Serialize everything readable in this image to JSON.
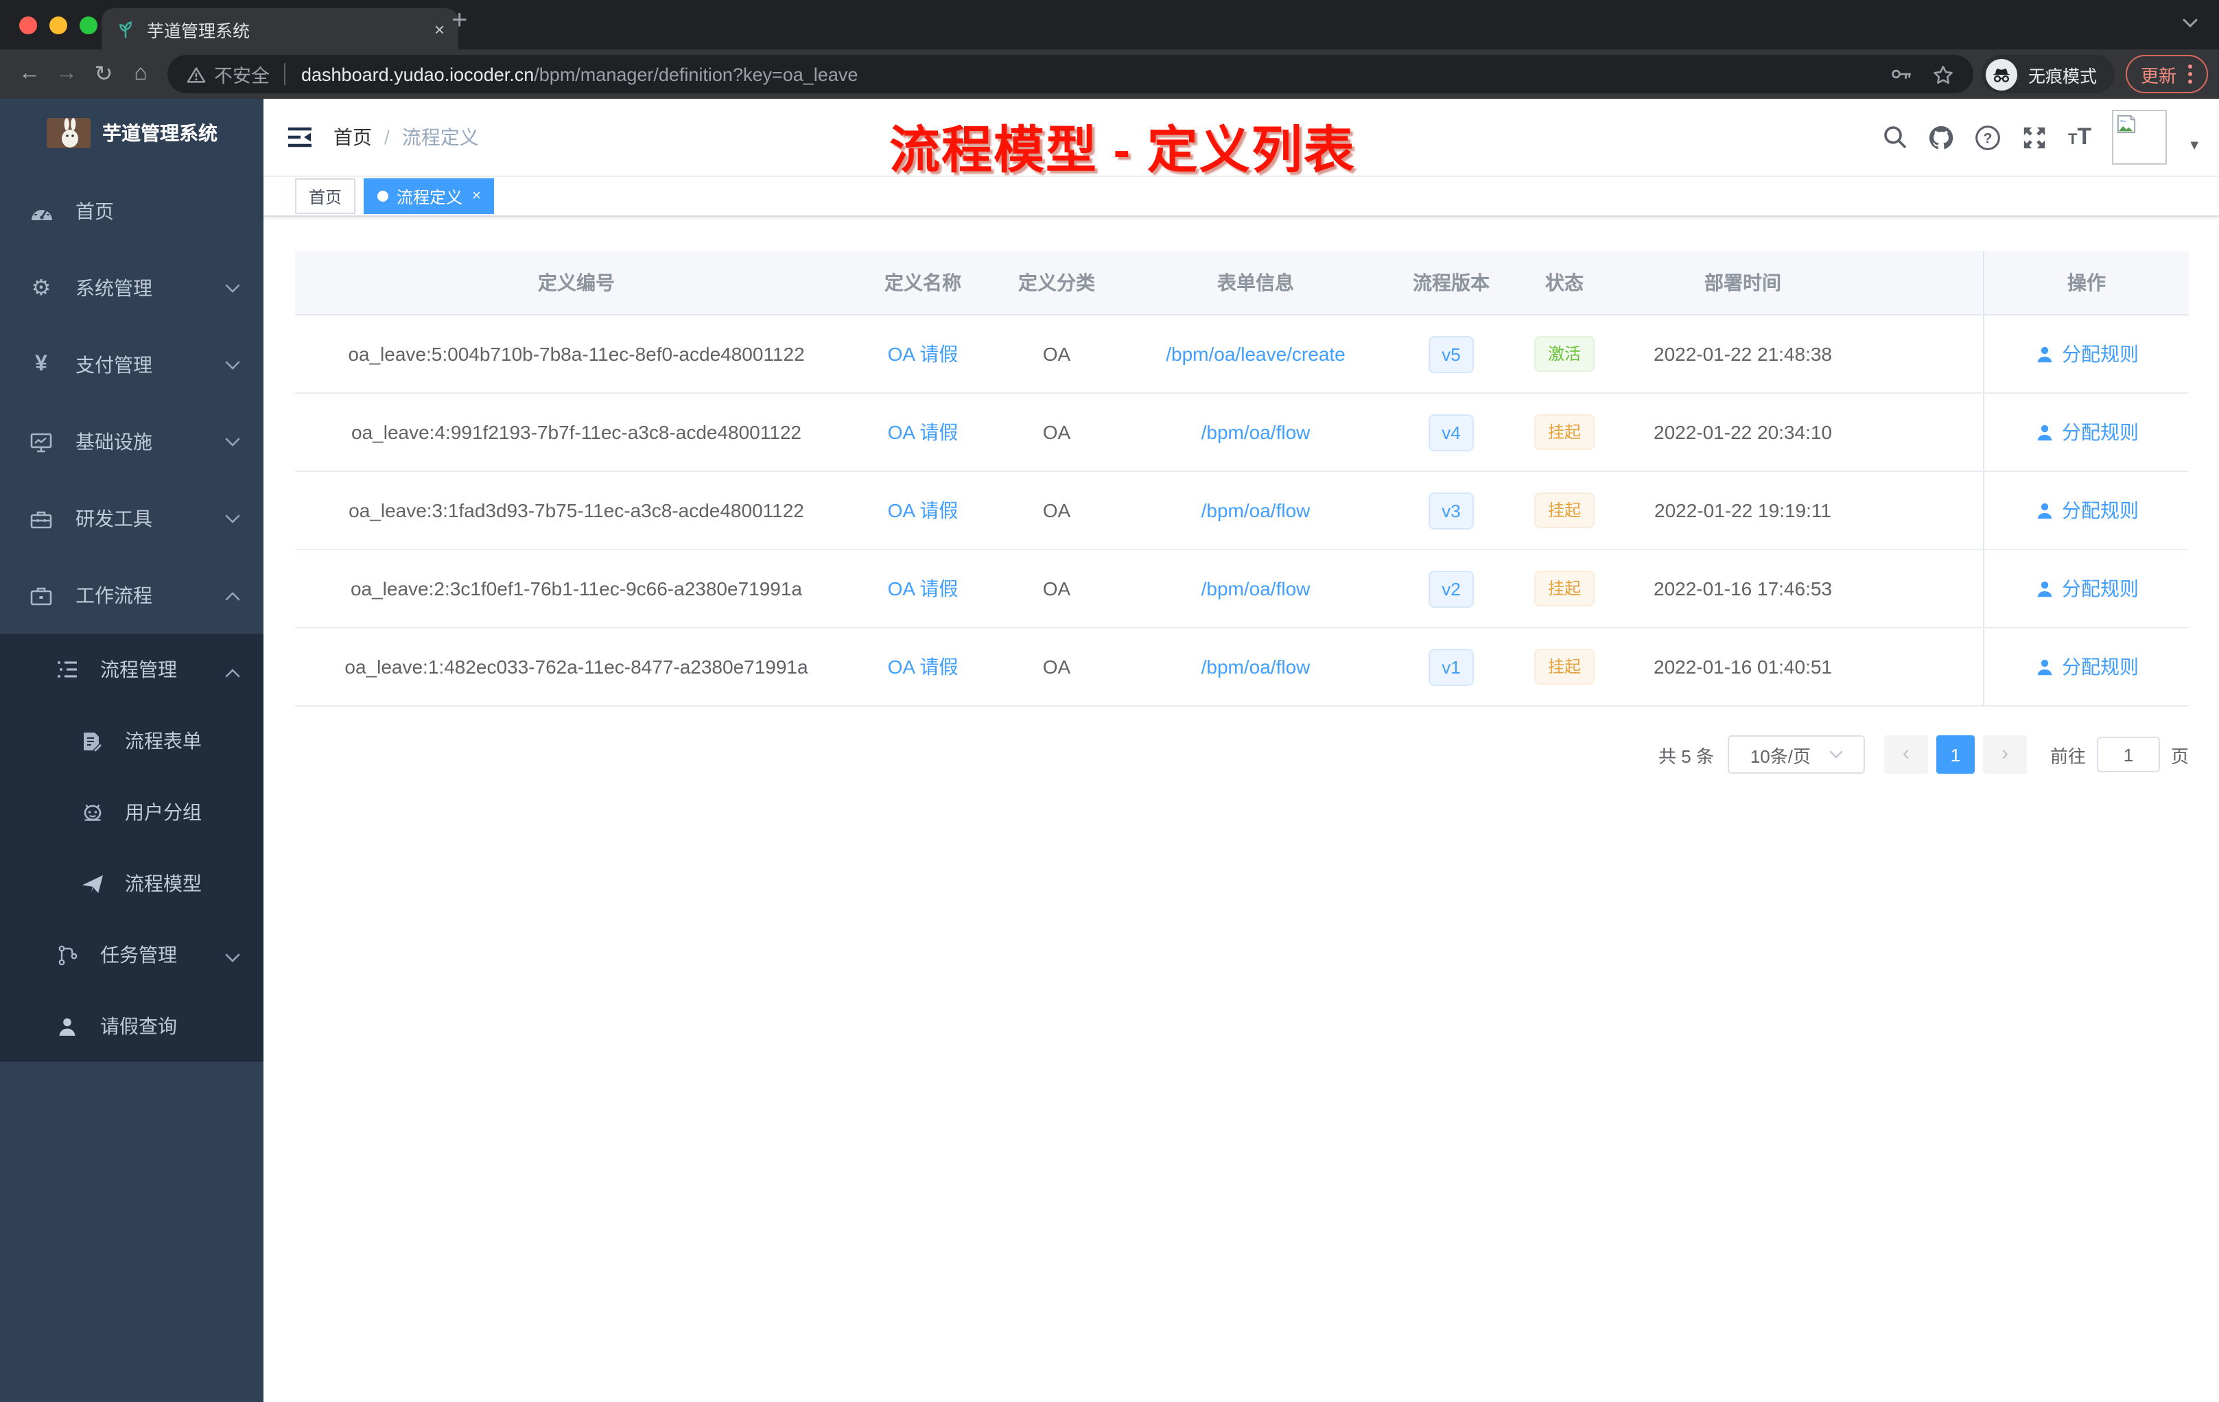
{
  "browser": {
    "tab": {
      "title": "芋道管理系统",
      "close_glyph": "×"
    },
    "new_tab_glyph": "+",
    "toolbar": {
      "insecure_label": "不安全",
      "url_domain": "dashboard.yudao.iocoder.cn",
      "url_path": "/bpm/manager/definition?key=oa_leave",
      "incognito_label": "无痕模式",
      "update_label": "更新"
    }
  },
  "sidebar": {
    "logo_title": "芋道管理系统",
    "items": [
      {
        "label": "首页",
        "icon": "dashboard-icon"
      },
      {
        "label": "系统管理",
        "icon": "gear-icon"
      },
      {
        "label": "支付管理",
        "icon": "yen-icon"
      },
      {
        "label": "基础设施",
        "icon": "monitor-icon"
      },
      {
        "label": "研发工具",
        "icon": "toolbox-icon"
      },
      {
        "label": "工作流程",
        "icon": "briefcase-icon"
      }
    ],
    "submenu": [
      {
        "label": "流程管理",
        "icon": "tree-list-icon"
      },
      {
        "label": "流程表单",
        "icon": "form-doc-icon"
      },
      {
        "label": "用户分组",
        "icon": "robot-icon"
      },
      {
        "label": "流程模型",
        "icon": "paper-plane-icon"
      },
      {
        "label": "任务管理",
        "icon": "flow-nodes-icon"
      },
      {
        "label": "请假查询",
        "icon": "person-icon"
      }
    ]
  },
  "header": {
    "breadcrumb_home": "首页",
    "separator": "/",
    "breadcrumb_current": "流程定义",
    "annotation": "流程模型 - 定义列表"
  },
  "tags": {
    "home": "首页",
    "active": "流程定义",
    "close_glyph": "×"
  },
  "table": {
    "headers": [
      "定义编号",
      "定义名称",
      "定义分类",
      "表单信息",
      "流程版本",
      "状态",
      "部署时间",
      "操作"
    ],
    "rows": [
      {
        "id": "oa_leave:5:004b710b-7b8a-11ec-8ef0-acde48001122",
        "name": "OA 请假",
        "category": "OA",
        "form": "/bpm/oa/leave/create",
        "version": "v5",
        "status": "激活",
        "time": "2022-01-22 21:48:38",
        "action": "分配规则"
      },
      {
        "id": "oa_leave:4:991f2193-7b7f-11ec-a3c8-acde48001122",
        "name": "OA 请假",
        "category": "OA",
        "form": "/bpm/oa/flow",
        "version": "v4",
        "status": "挂起",
        "time": "2022-01-22 20:34:10",
        "action": "分配规则"
      },
      {
        "id": "oa_leave:3:1fad3d93-7b75-11ec-a3c8-acde48001122",
        "name": "OA 请假",
        "category": "OA",
        "form": "/bpm/oa/flow",
        "version": "v3",
        "status": "挂起",
        "time": "2022-01-22 19:19:11",
        "action": "分配规则"
      },
      {
        "id": "oa_leave:2:3c1f0ef1-76b1-11ec-9c66-a2380e71991a",
        "name": "OA 请假",
        "category": "OA",
        "form": "/bpm/oa/flow",
        "version": "v2",
        "status": "挂起",
        "time": "2022-01-16 17:46:53",
        "action": "分配规则"
      },
      {
        "id": "oa_leave:1:482ec033-762a-11ec-8477-a2380e71991a",
        "name": "OA 请假",
        "category": "OA",
        "form": "/bpm/oa/flow",
        "version": "v1",
        "status": "挂起",
        "time": "2022-01-16 01:40:51",
        "action": "分配规则"
      }
    ]
  },
  "pagination": {
    "total": "共 5 条",
    "page_size": "10条/页",
    "prev": "‹",
    "page": "1",
    "next": "›",
    "goto_label": "前往",
    "goto_value": "1",
    "unit": "页"
  },
  "colors": {
    "accent": "#409eff",
    "success": "#67c23a",
    "warning": "#e6a23c",
    "sidebar_bg": "#304156",
    "submenu_bg": "#1f2d3d",
    "annotation_red": "#fb1303"
  }
}
